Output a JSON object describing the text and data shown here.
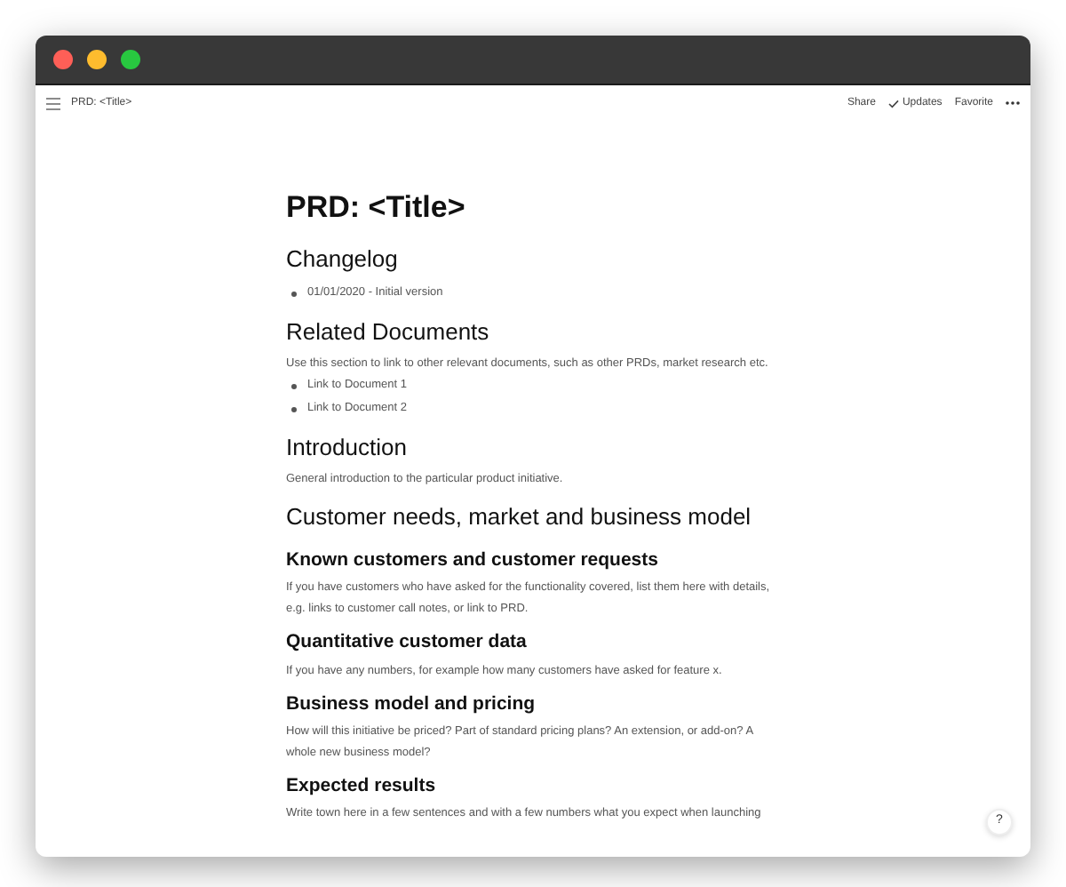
{
  "window": {
    "buttons": [
      {
        "kind": "close"
      },
      {
        "kind": "minimize"
      },
      {
        "kind": "maximize"
      }
    ]
  },
  "topbar": {
    "breadcrumb": "PRD: <Title>",
    "actions": [
      {
        "label": "Share",
        "kind": "text"
      },
      {
        "label": "Updates",
        "kind": "check"
      },
      {
        "label": "Favorite",
        "kind": "text"
      }
    ]
  },
  "document": {
    "blocks": [
      {
        "kind": "title",
        "text": "PRD: <Title>"
      },
      {
        "kind": "h2",
        "text": "Changelog"
      },
      {
        "kind": "bullet",
        "text": "01/01/2020 - Initial version"
      },
      {
        "kind": "h2",
        "text": "Related Documents"
      },
      {
        "kind": "p",
        "text": "Use this section to link to other relevant documents, such as other PRDs, market research etc."
      },
      {
        "kind": "bullet",
        "text": "Link to Document 1"
      },
      {
        "kind": "bullet",
        "text": "Link to Document 2"
      },
      {
        "kind": "h2",
        "text": "Introduction"
      },
      {
        "kind": "p",
        "text": "General introduction to the particular product initiative."
      },
      {
        "kind": "h2",
        "text": "Customer needs, market and business model"
      },
      {
        "kind": "h3",
        "text": "Known customers and customer requests"
      },
      {
        "kind": "p",
        "text": "If you have customers who have asked for the functionality covered, list them here with details, e.g. links to customer call notes, or link to PRD."
      },
      {
        "kind": "h3",
        "text": "Quantitative customer data"
      },
      {
        "kind": "p",
        "text": "If you have any numbers, for example how many customers have asked for feature x."
      },
      {
        "kind": "h3",
        "text": "Business model and pricing"
      },
      {
        "kind": "p",
        "text": "How will this initiative be priced? Part of standard pricing plans? An extension, or add-on? A whole new business model?"
      },
      {
        "kind": "h3",
        "text": "Expected results"
      },
      {
        "kind": "p",
        "text": "Write town here in a few sentences and with a few numbers what you expect when launching"
      }
    ]
  },
  "help_button": {
    "label": "?"
  }
}
